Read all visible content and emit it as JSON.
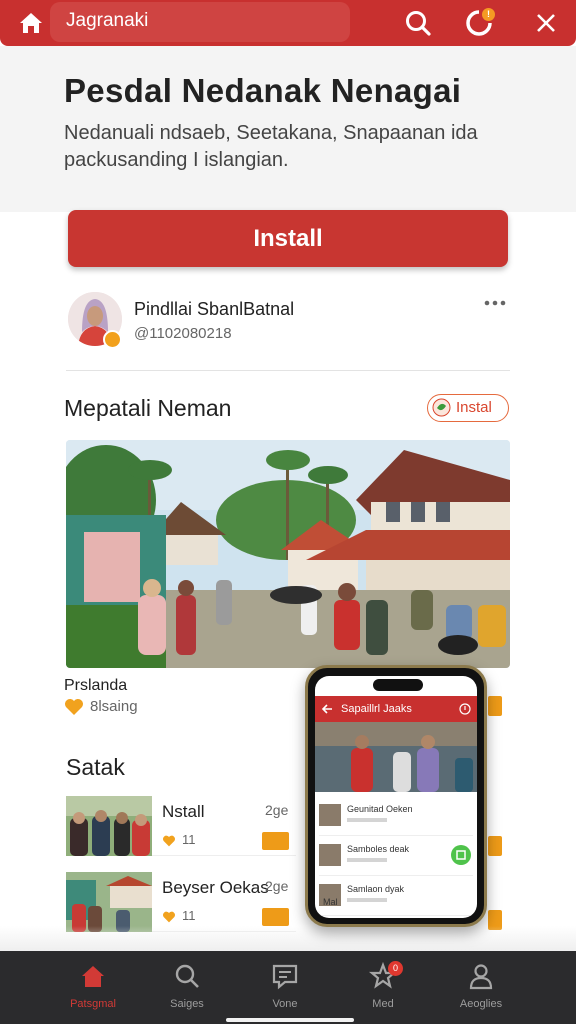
{
  "topbar": {
    "title": "Jagranaki",
    "notification_badge": "!",
    "icons": [
      "home-icon",
      "search-icon",
      "notification-icon",
      "close-icon"
    ]
  },
  "app": {
    "name": "Pesdal Nedanak Nenagai",
    "description": "Nedanuali ndsaeb, Seetakana, Snapaanan ida packusanding I islangian.",
    "install_label": "Install"
  },
  "developer": {
    "name": "Pindllai SbanlBatnal",
    "id": "@1102080218"
  },
  "section1": {
    "title": "Mepatali Neman",
    "install_chip": "Instal",
    "caption": "Prslanda",
    "rating": "8lsaing"
  },
  "section2": {
    "title": "Satak",
    "cards": [
      {
        "title": "Nstall",
        "num": "2ge",
        "likes": "11"
      },
      {
        "title": "Beyser Oekas",
        "num": "2ge",
        "likes": "11"
      }
    ]
  },
  "phone": {
    "title": "Sapaillrl Jaaks",
    "rows": [
      "Geunitad Oeken",
      "Samboles deak",
      "Samlaon dyak"
    ],
    "footer": "Mal"
  },
  "bottomnav": {
    "items": [
      {
        "label": "Patsgmal",
        "icon": "home-icon",
        "active": true
      },
      {
        "label": "Saiges",
        "icon": "search-icon",
        "active": false
      },
      {
        "label": "Vone",
        "icon": "message-icon",
        "active": false
      },
      {
        "label": "Med",
        "icon": "star-icon",
        "active": false,
        "badge": "0"
      },
      {
        "label": "Aeoglies",
        "icon": "profile-icon",
        "active": false
      }
    ]
  },
  "colors": {
    "accent": "#c8302f",
    "orange": "#ee9b18",
    "nav_bg": "#2b2b2d"
  }
}
